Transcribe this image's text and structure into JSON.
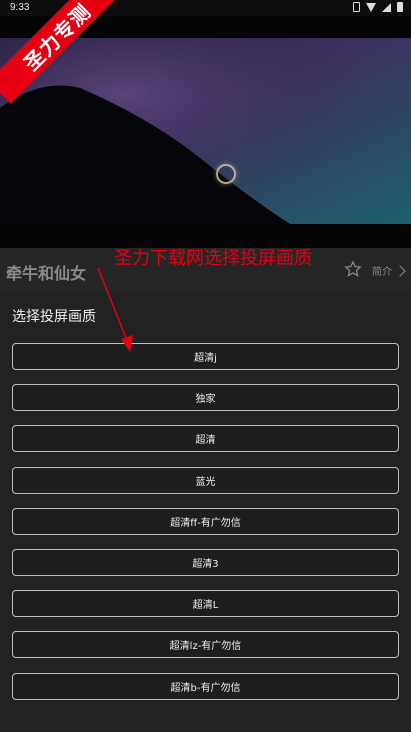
{
  "status_bar": {
    "time": "9:33"
  },
  "badge": {
    "text": "圣力专测"
  },
  "movie": {
    "title": "牵牛和仙女",
    "intro_label": "简介"
  },
  "annotation": {
    "text": "圣力下载网选择投屏画质",
    "color": "#e60012"
  },
  "sheet": {
    "title": "选择投屏画质",
    "options": [
      {
        "label": "超清j"
      },
      {
        "label": "独家"
      },
      {
        "label": "超清"
      },
      {
        "label": "蓝光"
      },
      {
        "label": "超清ff-有广勿信"
      },
      {
        "label": "超清3"
      },
      {
        "label": "超清L"
      },
      {
        "label": "超清lz-有广勿信"
      },
      {
        "label": "超清b-有广勿信"
      }
    ]
  },
  "icons": [
    "vibrate-icon",
    "wifi-icon",
    "signal-icon",
    "battery-icon",
    "star-icon",
    "chevron-right-icon",
    "loading-icon"
  ],
  "colors": {
    "badge_red": "#e60012",
    "sheet_bg": "#222222",
    "button_border": "#bdbdbd"
  }
}
